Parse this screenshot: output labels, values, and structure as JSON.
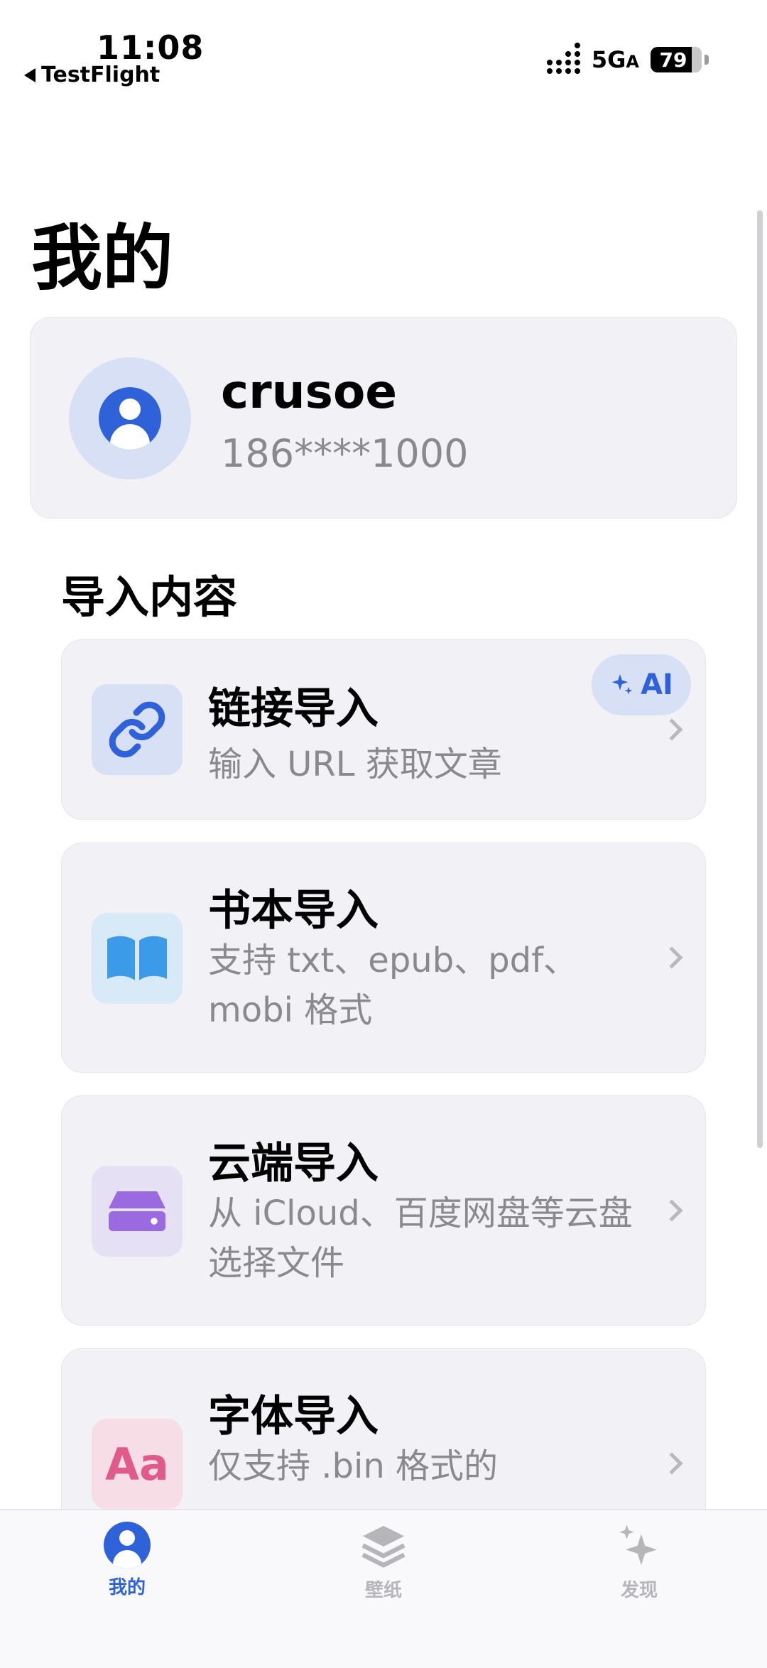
{
  "status_bar": {
    "time": "11:08",
    "back_label": "TestFlight",
    "network": "5G",
    "network_suffix": "A",
    "battery": "79"
  },
  "page": {
    "title": "我的"
  },
  "profile": {
    "username": "crusoe",
    "phone": "186****1000"
  },
  "import_section": {
    "title": "导入内容",
    "items": [
      {
        "title": "链接导入",
        "description": "输入 URL 获取文章",
        "icon": "link-icon",
        "badge": "AI"
      },
      {
        "title": "书本导入",
        "description": "支持 txt、epub、pdf、mobi 格式",
        "icon": "book-icon"
      },
      {
        "title": "云端导入",
        "description": "从 iCloud、百度网盘等云盘选择文件",
        "icon": "drive-icon"
      },
      {
        "title": "字体导入",
        "description": "仅支持 .bin 格式的",
        "icon_text": "Aa"
      }
    ]
  },
  "tabbar": {
    "tabs": [
      {
        "label": "我的",
        "icon": "profile-icon",
        "active": true
      },
      {
        "label": "壁纸",
        "icon": "layers-icon",
        "active": false
      },
      {
        "label": "发现",
        "icon": "sparkle-icon",
        "active": false
      }
    ]
  },
  "colors": {
    "accent": "#2F62D8",
    "card_bg": "#F1F1F6",
    "secondary_text": "#8A8A8E",
    "inactive_tab": "#B5B5BA"
  }
}
